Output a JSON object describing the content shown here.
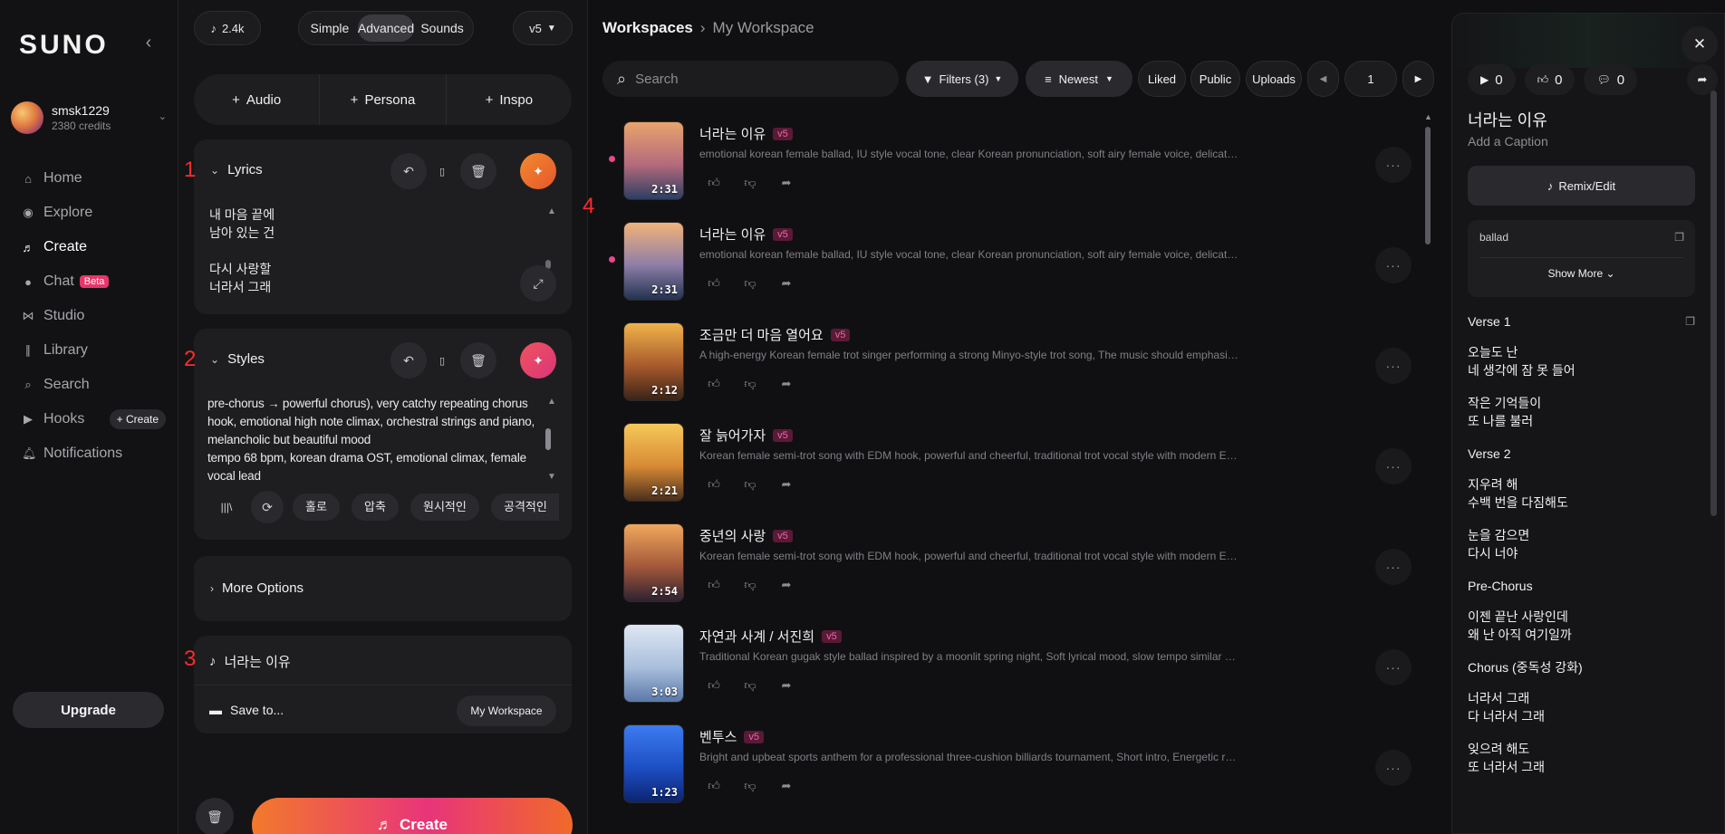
{
  "sidebar": {
    "logo": "SUNO",
    "user": {
      "name": "smsk1229",
      "credits": "2380 credits"
    },
    "nav": [
      {
        "label": "Home",
        "icon": "home-icon"
      },
      {
        "label": "Explore",
        "icon": "compass-icon"
      },
      {
        "label": "Create",
        "icon": "music-note-icon",
        "active": true
      },
      {
        "label": "Chat",
        "icon": "chat-icon",
        "badge": "Beta"
      },
      {
        "label": "Studio",
        "icon": "studio-icon"
      },
      {
        "label": "Library",
        "icon": "library-icon"
      },
      {
        "label": "Search",
        "icon": "search-icon"
      },
      {
        "label": "Hooks",
        "icon": "hooks-icon",
        "action": "+ Create"
      },
      {
        "label": "Notifications",
        "icon": "bell-icon"
      }
    ],
    "upgrade": "Upgrade"
  },
  "create": {
    "credits_chip": "2.4k",
    "mode_tabs": [
      "Simple",
      "Advanced",
      "Sounds"
    ],
    "active_tab": "Advanced",
    "model": "v5",
    "add_buttons": [
      "Audio",
      "Persona",
      "Inspo"
    ],
    "lyrics": {
      "title": "Lyrics",
      "lines_a": [
        "내 마음 끝에",
        "남아 있는 건"
      ],
      "lines_b": [
        "다시 사랑할",
        "너라서 그래"
      ]
    },
    "styles": {
      "title": "Styles",
      "text": "pre-chorus → powerful chorus), very catchy repeating chorus hook, emotional high note climax, orchestral strings and piano, melancholic but beautiful mood\ntempo 68 bpm, korean drama OST, emotional climax, female vocal lead",
      "tags": [
        "홀로",
        "압축",
        "원시적인",
        "공격적인"
      ]
    },
    "more_options": "More Options",
    "song_name": "너라는 이유",
    "save_to_label": "Save to...",
    "save_to_target": "My Workspace",
    "create_button": "Create",
    "markers": [
      "1",
      "2",
      "3",
      "4"
    ]
  },
  "main": {
    "breadcrumb": [
      "Workspaces",
      "My Workspace"
    ],
    "search_placeholder": "Search",
    "filters": "Filters (3)",
    "sort": "Newest",
    "filter_pills": [
      "Liked",
      "Public",
      "Uploads"
    ],
    "page": "1",
    "songs": [
      {
        "title": "너라는 이유",
        "tag": "v5",
        "desc": "emotional korean female ballad, IU style vocal tone, clear Korean pronunciation, soft airy female voice, delicate emotional delivery",
        "duration": "2:31",
        "dot": true,
        "colors": [
          "#e9a46c",
          "#b46a7c",
          "#2d3e62"
        ]
      },
      {
        "title": "너라는 이유",
        "tag": "v5",
        "desc": "emotional korean female ballad, IU style vocal tone, clear Korean pronunciation, soft airy female voice, delicate emotional delivery",
        "duration": "2:31",
        "dot": true,
        "colors": [
          "#f2b27a",
          "#8e7ea8",
          "#23324f"
        ]
      },
      {
        "title": "조금만 더 마음 열어요",
        "tag": "v5",
        "desc": "A high-energy Korean female trot singer performing a strong Minyo-style trot song, The music should emphasize traditional rhythm",
        "duration": "2:12",
        "dot": false,
        "colors": [
          "#f0b34a",
          "#a85a2c",
          "#3a2418"
        ]
      },
      {
        "title": "잘 늙어가자",
        "tag": "v5",
        "desc": "Korean female semi-trot song with EDM hook, powerful and cheerful, traditional trot vocal style with modern EDM drop",
        "duration": "2:21",
        "dot": false,
        "colors": [
          "#f6c85a",
          "#d88a35",
          "#4a2f1c"
        ]
      },
      {
        "title": "중년의 사랑",
        "tag": "v5",
        "desc": "Korean female semi-trot song with EDM hook, powerful and cheerful, traditional trot vocal style with modern EDM drop",
        "duration": "2:54",
        "dot": false,
        "colors": [
          "#f0a85c",
          "#a3583a",
          "#2e2230"
        ]
      },
      {
        "title": "자연과 사계 / 서진희",
        "tag": "v5",
        "desc": "Traditional Korean gugak style ballad inspired by a moonlit spring night, Soft lyrical mood, slow tempo similar to Semachi",
        "duration": "3:03",
        "dot": false,
        "colors": [
          "#dfe7f3",
          "#a9bfdc",
          "#5b78a8"
        ]
      },
      {
        "title": "벤투스",
        "tag": "v5",
        "desc": "Bright and upbeat sports anthem for a professional three-cushion billiards tournament, Short intro, Energetic rhythm and brass",
        "duration": "1:23",
        "dot": false,
        "colors": [
          "#3d7bf0",
          "#1d4fc4",
          "#0c2470"
        ]
      }
    ]
  },
  "detail": {
    "plays": "0",
    "likes": "0",
    "comments": "0",
    "title": "너라는 이유",
    "caption": "Add a Caption",
    "remix": "Remix/Edit",
    "tags_text": "ballad",
    "show_more": "Show More",
    "lyrics": [
      {
        "heading": "Verse 1"
      },
      {
        "lines": [
          "오늘도 난",
          "네 생각에 잠 못 들어"
        ]
      },
      {
        "lines": [
          "작은 기억들이",
          "또 나를 불러"
        ]
      },
      {
        "heading": "Verse 2"
      },
      {
        "lines": [
          "지우려 해",
          "수백 번을 다짐해도"
        ]
      },
      {
        "lines": [
          "눈을 감으면",
          "다시 너야"
        ]
      },
      {
        "heading": "Pre-Chorus"
      },
      {
        "lines": [
          "이젠 끝난 사랑인데",
          "왜 난 아직 여기일까"
        ]
      },
      {
        "heading": "Chorus (중독성 강화)"
      },
      {
        "lines": [
          "너라서 그래",
          "다 너라서 그래"
        ]
      },
      {
        "lines": [
          "잊으려 해도",
          "또 너라서 그래"
        ]
      }
    ]
  }
}
